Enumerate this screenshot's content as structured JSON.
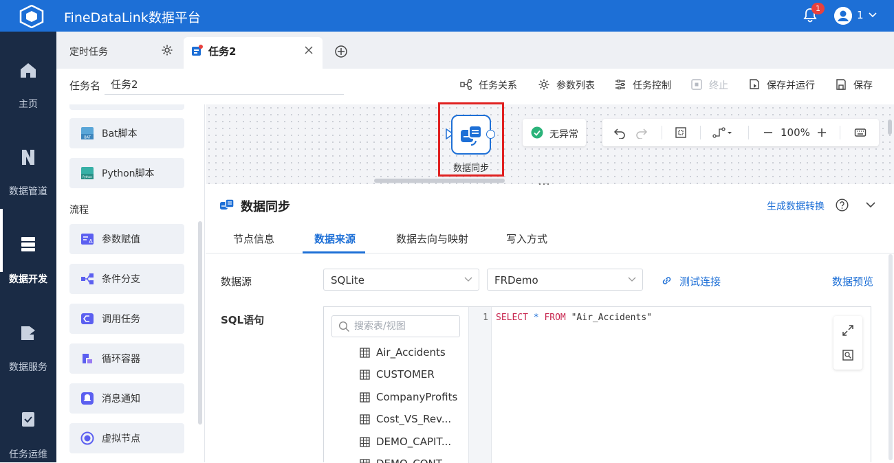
{
  "header": {
    "title": "FineDataLink数据平台",
    "notification_count": "1",
    "user_label": "1"
  },
  "nav": [
    {
      "label": "主页",
      "icon": "home-icon"
    },
    {
      "label": "数据管道",
      "icon": "data-pipeline-icon"
    },
    {
      "label": "数据开发",
      "icon": "data-development-icon",
      "active": true
    },
    {
      "label": "数据服务",
      "icon": "data-service-icon"
    },
    {
      "label": "任务运维",
      "icon": "task-ops-icon"
    }
  ],
  "tabs": {
    "tab1": "定时任务",
    "tab2": "任务2"
  },
  "task": {
    "name_label": "任务名",
    "name_value": "任务2",
    "toolbar": {
      "relation": "任务关系",
      "params": "参数列表",
      "control": "任务控制",
      "stop": "终止",
      "save_run": "保存并运行",
      "save": "保存"
    }
  },
  "palette": {
    "items_top": [
      "Bat脚本",
      "Python脚本"
    ],
    "section": "流程",
    "items": [
      "参数赋值",
      "条件分支",
      "调用任务",
      "循环容器",
      "消息通知",
      "虚拟节点"
    ]
  },
  "canvas": {
    "node_label": "数据同步",
    "status": "无异常",
    "zoom": "100%"
  },
  "panel": {
    "title": "数据同步",
    "generate_link": "生成数据转换",
    "tabs": [
      "节点信息",
      "数据来源",
      "数据去向与映射",
      "写入方式"
    ],
    "active_tab": "数据来源",
    "datasource_label": "数据源",
    "datasource_type": "SQLite",
    "datasource_conn": "FRDemo",
    "test_connection": "测试连接",
    "preview": "数据预览",
    "sql_label": "SQL语句",
    "search_placeholder": "搜索表/视图",
    "tables": [
      "Air_Accidents",
      "CUSTOMER",
      "CompanyProfits",
      "Cost_VS_Rev...",
      "DEMO_CAPIT...",
      "DEMO_CONT..."
    ],
    "line_number": "1",
    "sql": {
      "kw1": "SELECT",
      "star": "*",
      "kw2": "FROM",
      "table": "\"Air_Accidents\""
    }
  },
  "colors": {
    "brand": "#1d6fd6",
    "nav_bg": "#1a2b45",
    "highlight": "#e02020",
    "success": "#2bb37a"
  }
}
